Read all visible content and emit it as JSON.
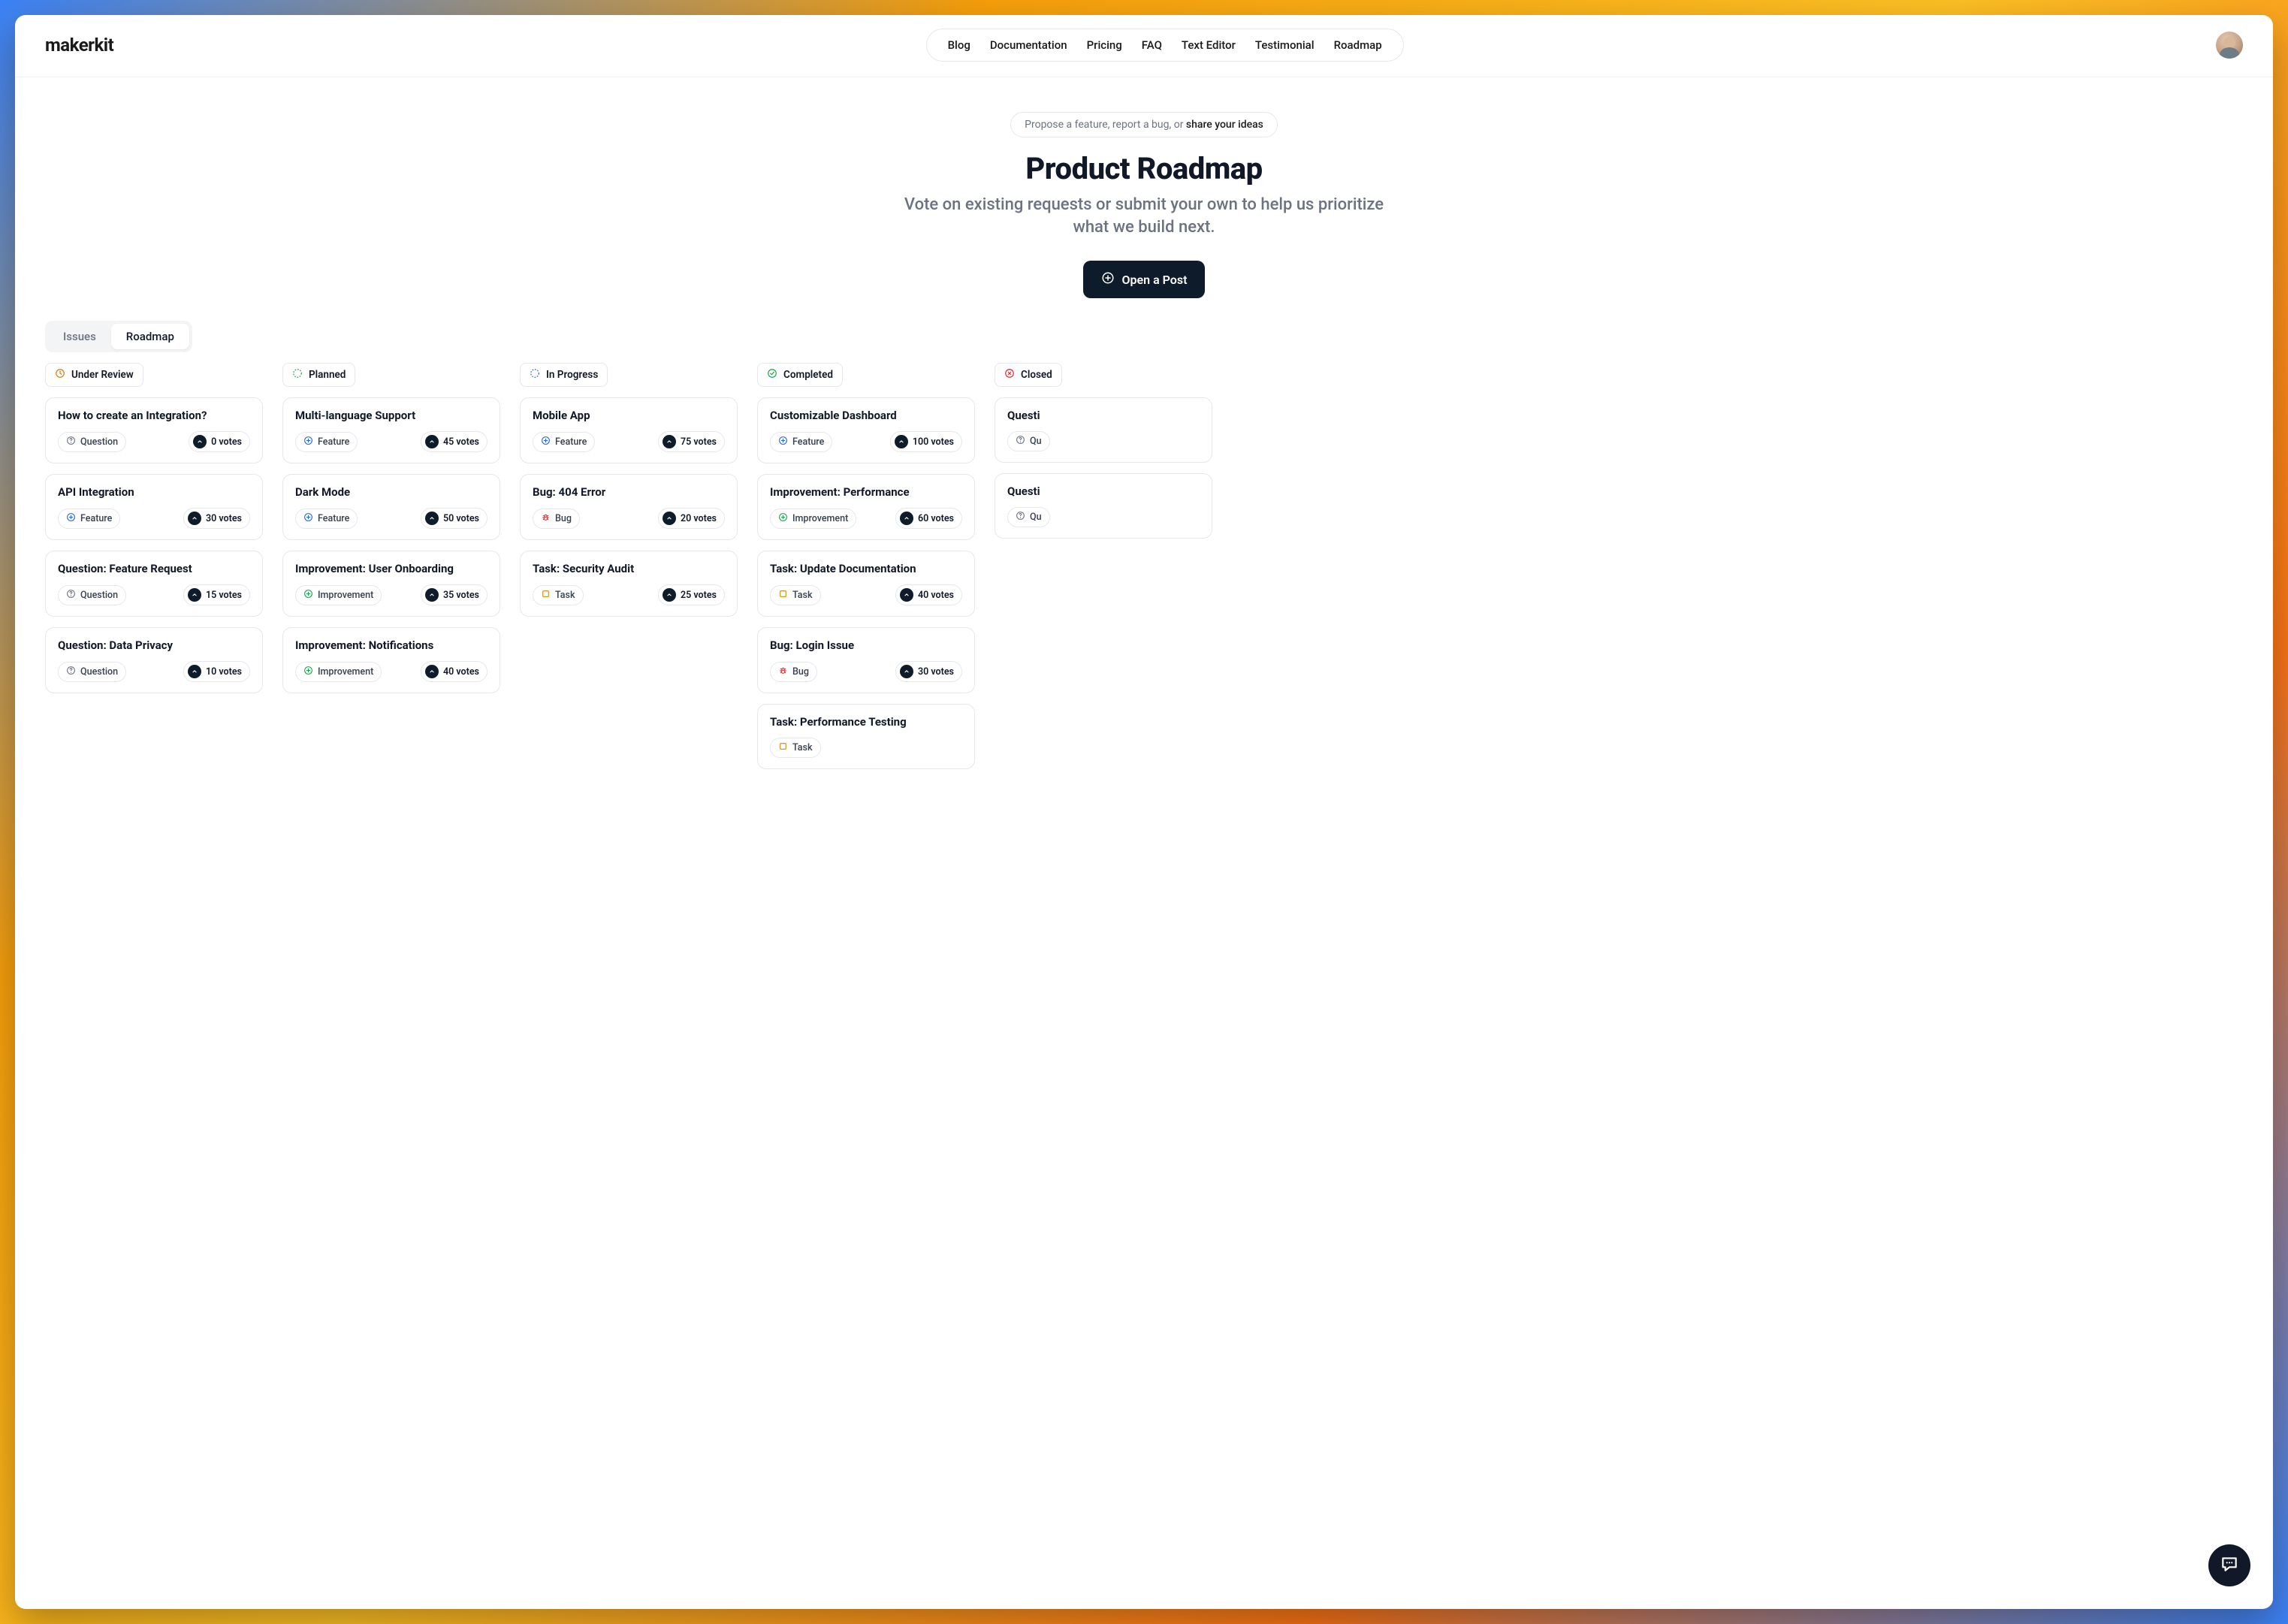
{
  "brand": "makerkit",
  "nav": [
    "Blog",
    "Documentation",
    "Pricing",
    "FAQ",
    "Text Editor",
    "Testimonial",
    "Roadmap"
  ],
  "hero": {
    "chip_lead": "Propose a feature, report a bug, or ",
    "chip_strong": "share your ideas",
    "title": "Product Roadmap",
    "subtitle": "Vote on existing requests or submit your own to help us prioritize what we build next.",
    "cta": "Open a Post"
  },
  "tabs": {
    "issues": "Issues",
    "roadmap": "Roadmap"
  },
  "columns": [
    {
      "key": "under-review",
      "label": "Under Review",
      "icon": "clock",
      "iconColor": "ic-amber",
      "cards": [
        {
          "title": "How to create an Integration?",
          "tag": "Question",
          "tagIcon": "help",
          "tagColor": "ic-gray",
          "votes": "0 votes"
        },
        {
          "title": "API Integration",
          "tag": "Feature",
          "tagIcon": "plus-circle",
          "tagColor": "ic-blue",
          "votes": "30 votes"
        },
        {
          "title": "Question: Feature Request",
          "tag": "Question",
          "tagIcon": "help",
          "tagColor": "ic-gray",
          "votes": "15 votes"
        },
        {
          "title": "Question: Data Privacy",
          "tag": "Question",
          "tagIcon": "help",
          "tagColor": "ic-gray",
          "votes": "10 votes"
        }
      ]
    },
    {
      "key": "planned",
      "label": "Planned",
      "icon": "dashed-circle",
      "iconColor": "ic-green",
      "cards": [
        {
          "title": "Multi-language Support",
          "tag": "Feature",
          "tagIcon": "plus-circle",
          "tagColor": "ic-blue",
          "votes": "45 votes"
        },
        {
          "title": "Dark Mode",
          "tag": "Feature",
          "tagIcon": "plus-circle",
          "tagColor": "ic-blue",
          "votes": "50 votes"
        },
        {
          "title": "Improvement: User Onboarding",
          "tag": "Improvement",
          "tagIcon": "plus-circle",
          "tagColor": "ic-green",
          "votes": "35 votes"
        },
        {
          "title": "Improvement: Notifications",
          "tag": "Improvement",
          "tagIcon": "plus-circle",
          "tagColor": "ic-green",
          "votes": "40 votes"
        }
      ]
    },
    {
      "key": "in-progress",
      "label": "In Progress",
      "icon": "dashed-circle",
      "iconColor": "ic-blue",
      "cards": [
        {
          "title": "Mobile App",
          "tag": "Feature",
          "tagIcon": "plus-circle",
          "tagColor": "ic-blue",
          "votes": "75 votes"
        },
        {
          "title": "Bug: 404 Error",
          "tag": "Bug",
          "tagIcon": "bug",
          "tagColor": "ic-red",
          "votes": "20 votes"
        },
        {
          "title": "Task: Security Audit",
          "tag": "Task",
          "tagIcon": "square",
          "tagColor": "ic-yellow",
          "votes": "25 votes"
        }
      ]
    },
    {
      "key": "completed",
      "label": "Completed",
      "icon": "check-circle",
      "iconColor": "ic-greenfill",
      "cards": [
        {
          "title": "Customizable Dashboard",
          "tag": "Feature",
          "tagIcon": "plus-circle",
          "tagColor": "ic-blue",
          "votes": "100 votes"
        },
        {
          "title": "Improvement: Performance",
          "tag": "Improvement",
          "tagIcon": "plus-circle",
          "tagColor": "ic-green",
          "votes": "60 votes"
        },
        {
          "title": "Task: Update Documentation",
          "tag": "Task",
          "tagIcon": "square",
          "tagColor": "ic-yellow",
          "votes": "40 votes"
        },
        {
          "title": "Bug: Login Issue",
          "tag": "Bug",
          "tagIcon": "bug",
          "tagColor": "ic-red",
          "votes": "30 votes"
        },
        {
          "title": "Task: Performance Testing",
          "tag": "Task",
          "tagIcon": "square",
          "tagColor": "ic-yellow",
          "votes": ""
        }
      ]
    },
    {
      "key": "closed",
      "label": "Closed",
      "icon": "x-circle",
      "iconColor": "ic-red",
      "cards": [
        {
          "title": "Questi",
          "tag": "Qu",
          "tagIcon": "help",
          "tagColor": "ic-gray",
          "votes": ""
        },
        {
          "title": "Questi",
          "tag": "Qu",
          "tagIcon": "help",
          "tagColor": "ic-gray",
          "votes": ""
        }
      ]
    }
  ]
}
